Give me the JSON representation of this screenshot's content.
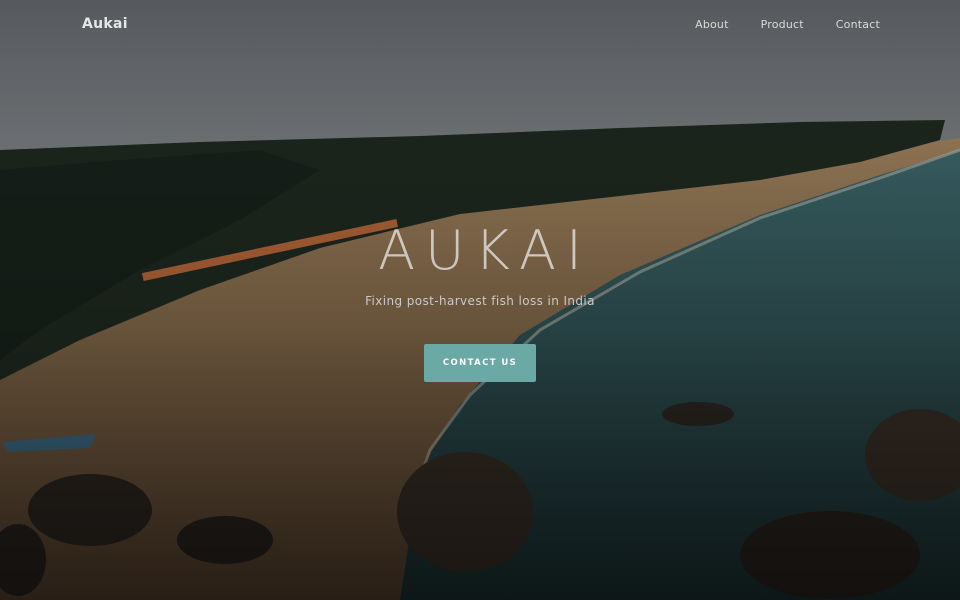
{
  "nav": {
    "brand": "Aukai",
    "links": [
      "About",
      "Product",
      "Contact"
    ]
  },
  "hero": {
    "title": "AUKAI",
    "subtitle": "Fixing post-harvest fish loss in India",
    "cta_label": "CONTACT US",
    "background": "aerial-beach-coastline-photo"
  },
  "colors": {
    "accent": "#6aa9a6",
    "sea": "#2f5357",
    "sand": "#8a6e4e",
    "forest": "#1f2a20"
  }
}
